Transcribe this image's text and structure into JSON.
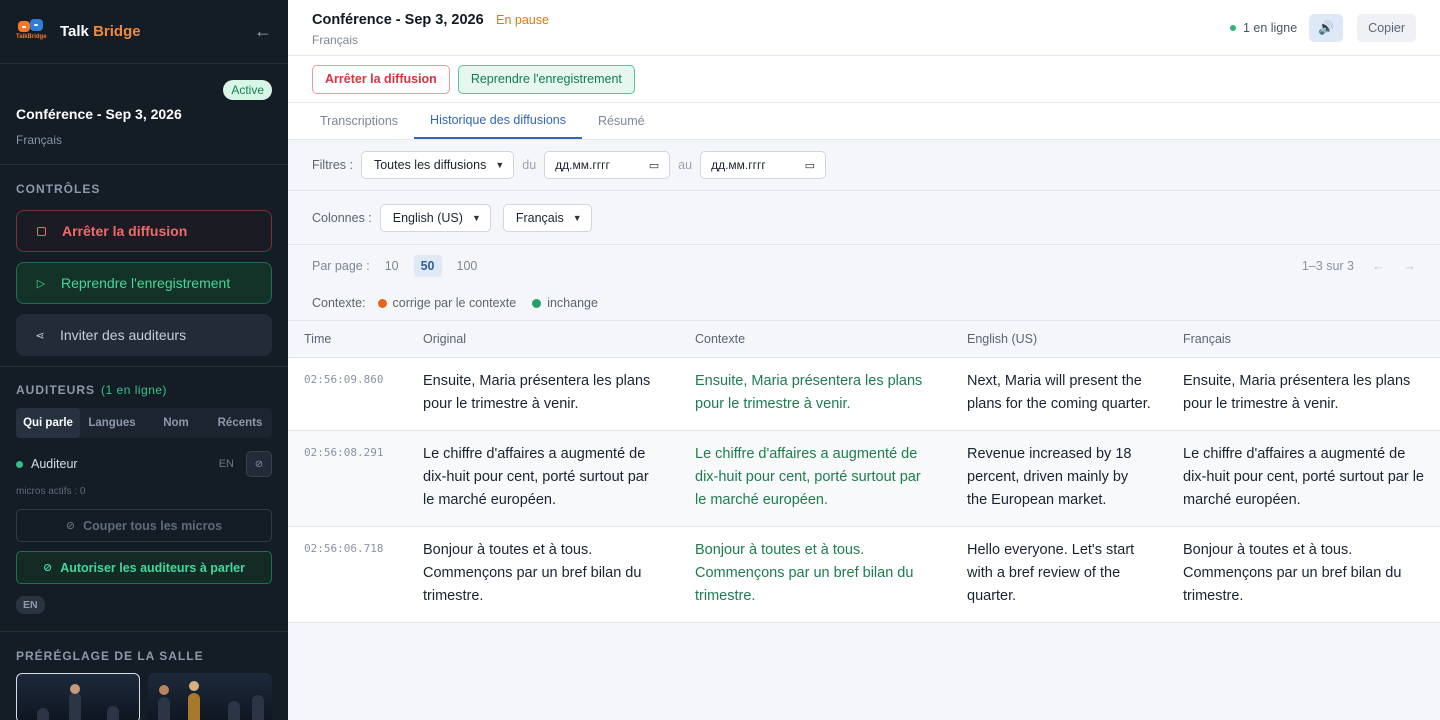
{
  "app": {
    "brand_first": "Talk",
    "brand_second": "Bridge",
    "logo_text": "TalkBridge"
  },
  "conference": {
    "badge": "Active",
    "title": "Conférence - Sep 3, 2026",
    "language": "Français"
  },
  "controls": {
    "section_title": "CONTRÔLES",
    "stop_label": "Arrêter la diffusion",
    "resume_label": "Reprendre l'enregistrement",
    "invite_label": "Inviter des auditeurs"
  },
  "listeners": {
    "section_title": "AUDITEURS",
    "online_count": "(1 en ligne)",
    "tabs": [
      "Qui parle",
      "Langues",
      "Nom",
      "Récents"
    ],
    "items": [
      {
        "name": "Auditeur",
        "lang": "EN"
      }
    ],
    "active_mics": "micros actifs : 0",
    "mute_all_label": "Couper tous les micros",
    "allow_label": "Autoriser les auditeurs à parler",
    "lang_chip": "EN"
  },
  "preset": {
    "section_title": "PRÉRÉGLAGE DE LA SALLE"
  },
  "topbar": {
    "title": "Conférence - Sep 3, 2026",
    "status": "En pause",
    "language": "Français",
    "online": "1 en ligne",
    "speaker_icon": "🔊",
    "copy_label": "Copier"
  },
  "actionbar": {
    "stop_label": "Arrêter la diffusion",
    "resume_label": "Reprendre l'enregistrement"
  },
  "view_tabs": [
    "Transcriptions",
    "Historique des diffusions",
    "Résumé"
  ],
  "filters": {
    "label": "Filtres :",
    "broadcast_select": "Toutes les diffusions",
    "from_label": "du",
    "from_date": "дд.мм.гггг",
    "to_label": "au",
    "to_date": "дд.мм.гггг"
  },
  "columns": {
    "label": "Colonnes :",
    "col1": "English (US)",
    "col2": "Français"
  },
  "pager": {
    "label": "Par page :",
    "options": [
      "10",
      "50",
      "100"
    ],
    "summary": "1–3 sur 3",
    "prev": "←",
    "next": "→"
  },
  "legend": {
    "label": "Contexte:",
    "item1": "corrige par le contexte",
    "item2": "inchange",
    "color1": "#e5641c",
    "color2": "#22a06b"
  },
  "table": {
    "headers": [
      "Time",
      "Original",
      "Contexte",
      "English (US)",
      "Français"
    ],
    "rows": [
      {
        "time": "02:56:09.860",
        "original": "Ensuite, Maria présentera les plans pour le trimestre à venir.",
        "context": "Ensuite, Maria présentera les plans pour le trimestre à venir.",
        "english": "Next, Maria will present the plans for the coming quarter.",
        "french": "Ensuite, Maria présentera les plans pour le trimestre à venir."
      },
      {
        "time": "02:56:08.291",
        "original": "Le chiffre d'affaires a augmenté de dix-huit pour cent, porté surtout par le marché européen.",
        "context": "Le chiffre d'affaires a augmenté de dix-huit pour cent, porté surtout par le marché européen.",
        "english": "Revenue increased by 18 percent, driven mainly by the European market.",
        "french": "Le chiffre d'affaires a augmenté de dix-huit pour cent, porté surtout par le marché européen."
      },
      {
        "time": "02:56:06.718",
        "original": "Bonjour à toutes et à tous. Commençons par un bref bilan du trimestre.",
        "context": "Bonjour à toutes et à tous. Commençons par un bref bilan du trimestre.",
        "english": "Hello everyone. Let's start with a bref review of the quarter.",
        "french": "Bonjour à toutes et à tous. Commençons par un bref bilan du trimestre."
      }
    ]
  }
}
